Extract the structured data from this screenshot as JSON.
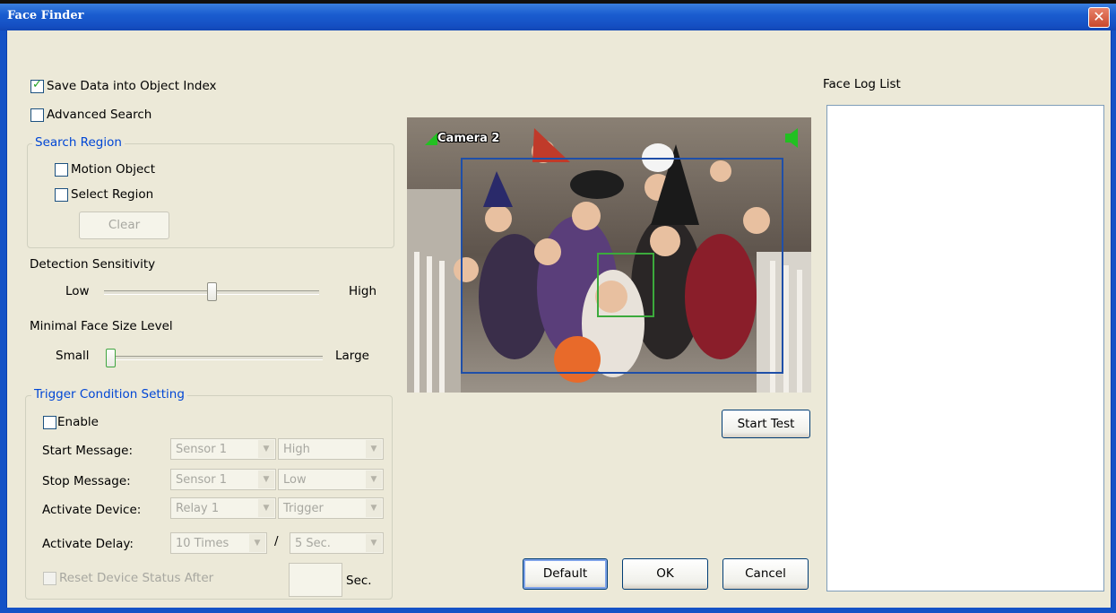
{
  "window": {
    "title": "Face Finder",
    "close_symbol": "✕"
  },
  "options": {
    "save_data": {
      "label": "Save Data into Object Index",
      "checked": true
    },
    "advanced_search": {
      "label": "Advanced Search",
      "checked": false
    }
  },
  "search_region": {
    "title": "Search Region",
    "motion_object": {
      "label": "Motion Object",
      "checked": false
    },
    "select_region": {
      "label": "Select Region",
      "checked": false
    },
    "clear_label": "Clear"
  },
  "detection_sensitivity": {
    "title": "Detection Sensitivity",
    "low": "Low",
    "high": "High",
    "level": 0.5
  },
  "face_size": {
    "title": "Minimal Face Size Level",
    "small": "Small",
    "large": "Large",
    "level": 0.0
  },
  "trigger": {
    "title": "Trigger Condition Setting",
    "enable": {
      "label": "Enable",
      "checked": false
    },
    "start_message": {
      "label": "Start Message:",
      "sensor": "Sensor 1",
      "level": "High"
    },
    "stop_message": {
      "label": "Stop Message:",
      "sensor": "Sensor 1",
      "level": "Low"
    },
    "activate_device": {
      "label": "Activate Device:",
      "device": "Relay 1",
      "mode": "Trigger"
    },
    "activate_delay": {
      "label": "Activate Delay:",
      "times": "10 Times",
      "separator": "/",
      "seconds": "5 Sec."
    },
    "reset": {
      "label": "Reset Device Status After",
      "checked": false,
      "value": "",
      "unit": "Sec."
    }
  },
  "camera": {
    "label": "Camera 2"
  },
  "buttons": {
    "start_test": "Start Test",
    "default": "Default",
    "ok": "OK",
    "cancel": "Cancel"
  },
  "face_log": {
    "title": "Face Log List",
    "items": []
  },
  "colors": {
    "title_bar": "#1a5dd0",
    "client_bg": "#ece9d8",
    "group_title": "#0046d5",
    "region_box": "#1f4fa8",
    "face_box": "#3caa3c"
  }
}
